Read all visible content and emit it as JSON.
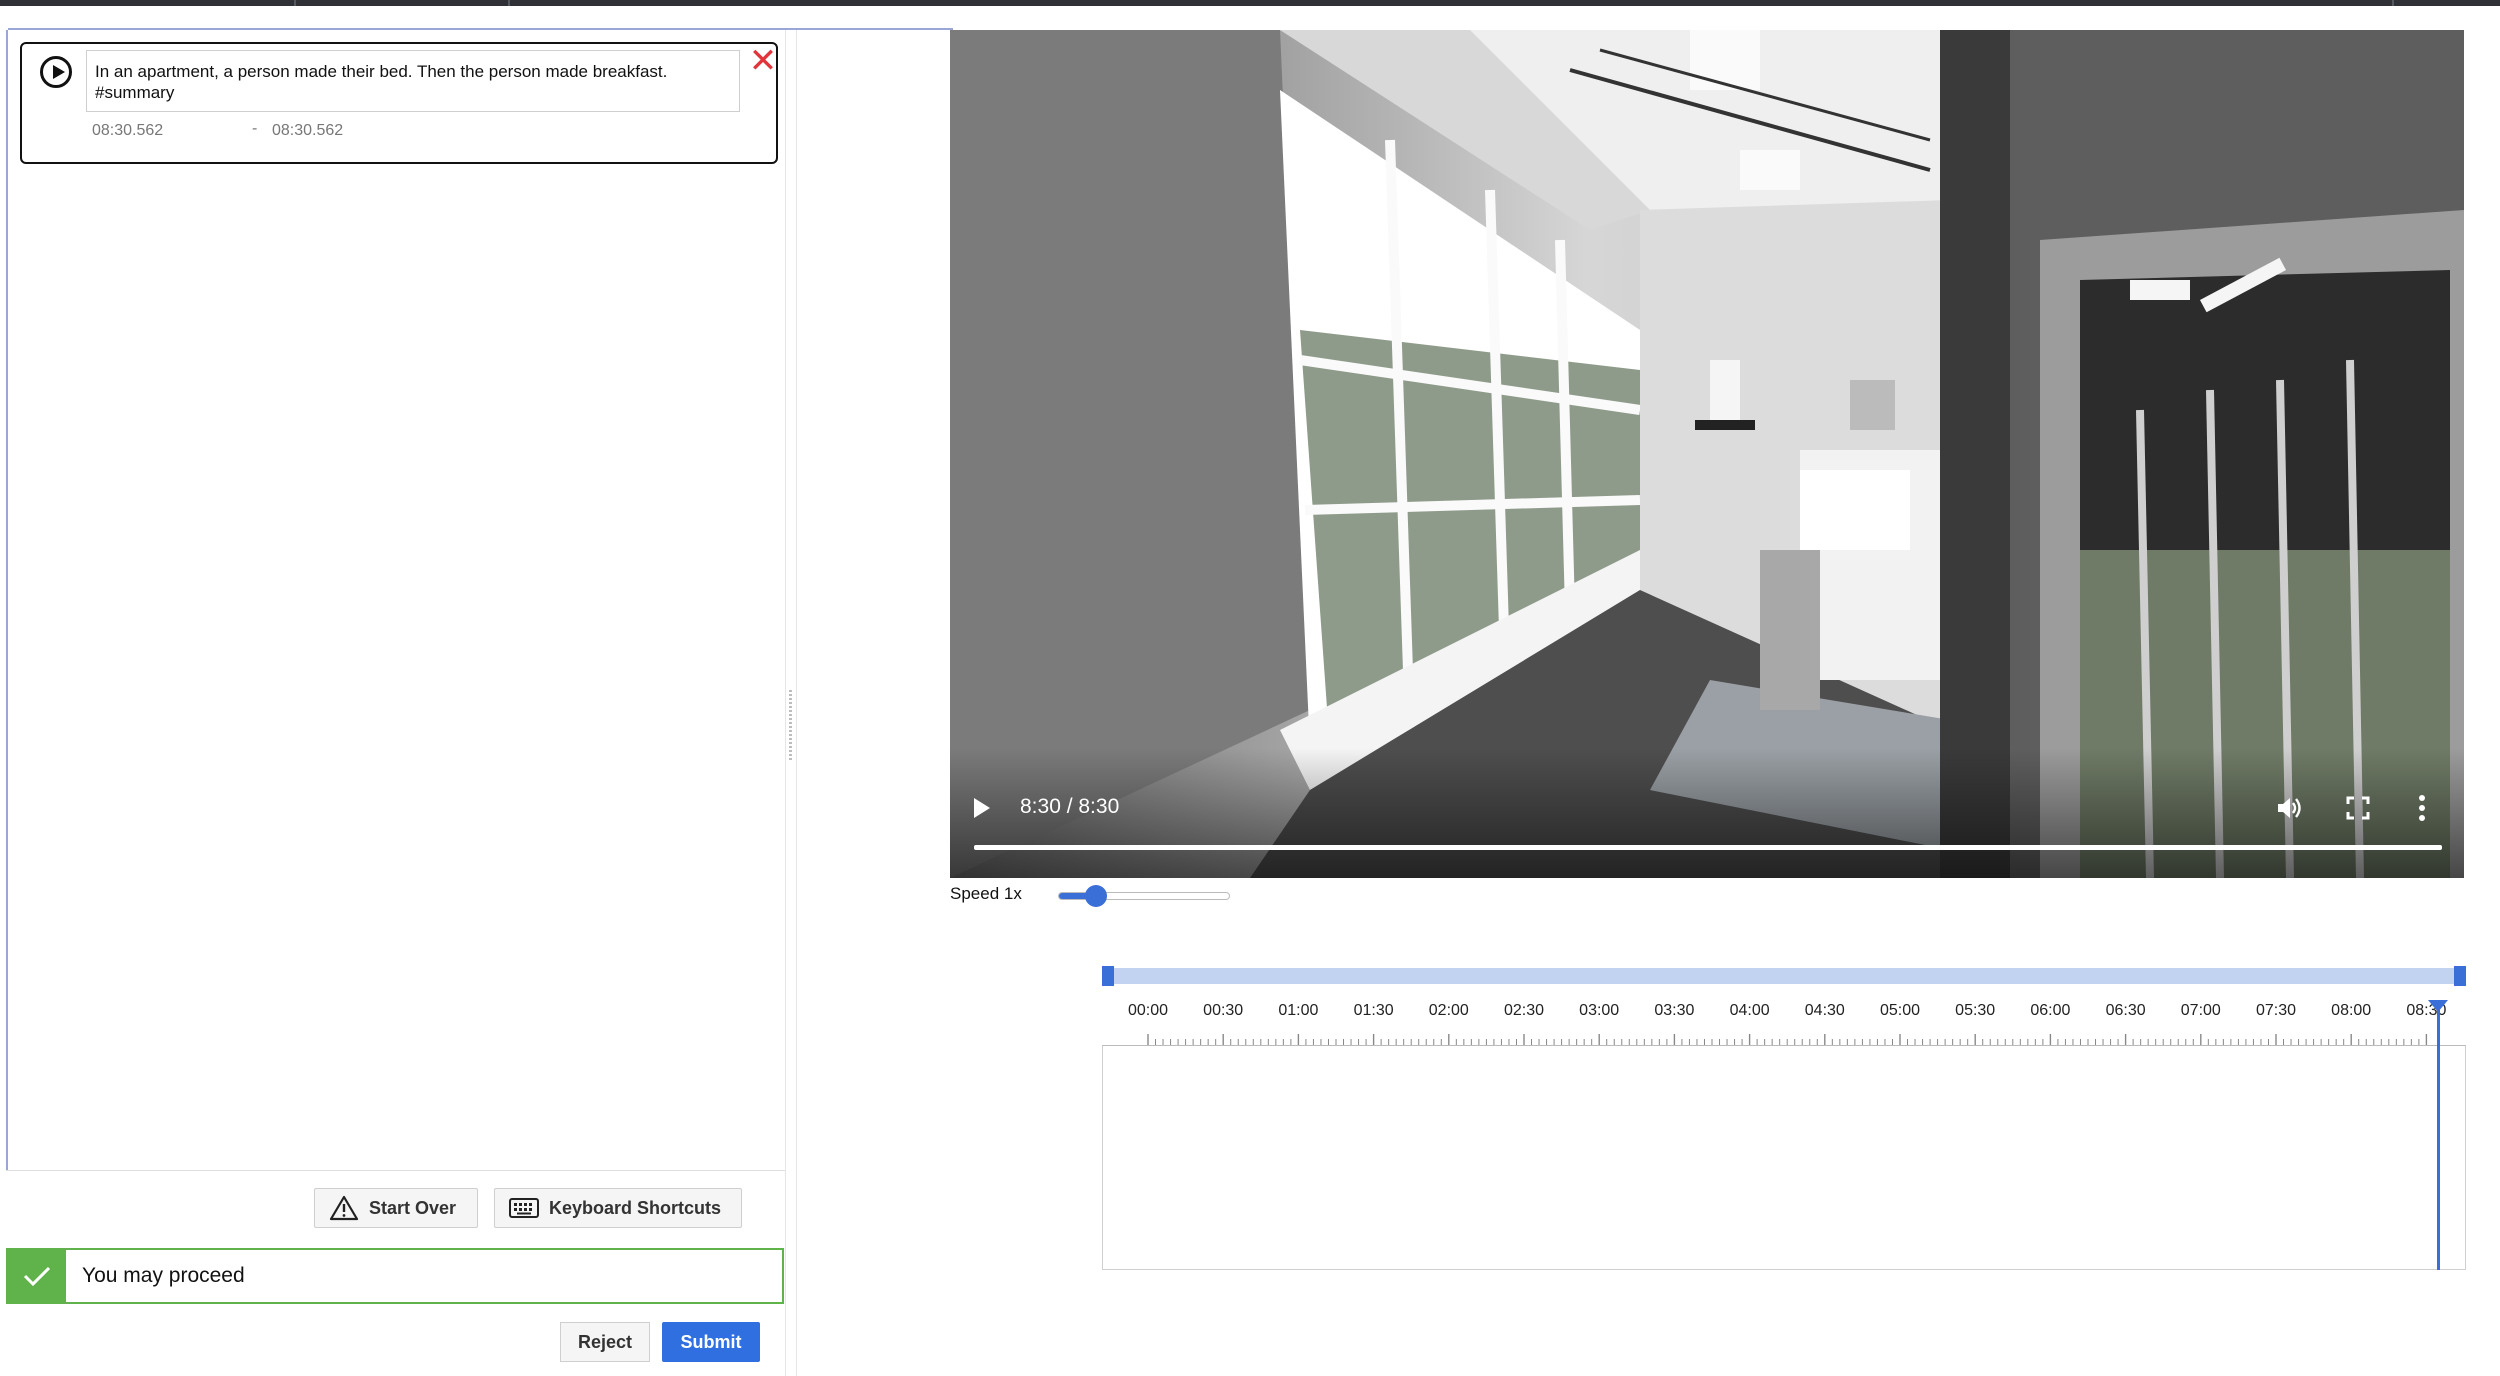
{
  "segment": {
    "description": "In an apartment, a person made their bed. Then the person made breakfast.\n#summary",
    "start_time": "08:30.562",
    "separator": "-",
    "end_time": "08:30.562"
  },
  "actions": {
    "start_over": "Start Over",
    "keyboard_shortcuts": "Keyboard Shortcuts",
    "reject": "Reject",
    "submit": "Submit"
  },
  "status": {
    "message": "You may proceed",
    "color": "#5fb34a"
  },
  "video": {
    "time_display": "8:30 / 8:30",
    "progress_fraction": 1.0
  },
  "speed": {
    "label": "Speed 1x",
    "slider_fraction": 0.22
  },
  "timeline": {
    "tick_labels": [
      "00:00",
      "00:30",
      "01:00",
      "01:30",
      "02:00",
      "02:30",
      "03:00",
      "03:30",
      "04:00",
      "04:30",
      "05:00",
      "05:30",
      "06:00",
      "06:30",
      "07:00",
      "07:30",
      "08:00",
      "08:30"
    ],
    "playhead_fraction": 0.9798,
    "accent_color": "#3a6fd8"
  }
}
